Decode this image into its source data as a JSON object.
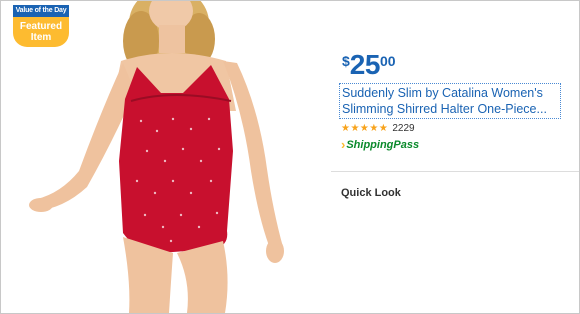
{
  "badge": {
    "top_label": "Value of the Day",
    "bottom_label": "Featured Item"
  },
  "product": {
    "price_currency": "$",
    "price_whole": "25",
    "price_cents": "00",
    "title": "Suddenly Slim by Catalina Women's Slimming Shirred Halter One-Piece...",
    "rating_stars": "★★★★★",
    "rating": 4.5,
    "review_count": "2229",
    "shipping_prefix": "Shipping",
    "shipping_suffix": "Pass"
  },
  "quick_look_label": "Quick Look",
  "colors": {
    "brand_blue": "#1a63b3",
    "badge_yellow": "#fdbb30",
    "swimsuit_red": "#c8102e",
    "shipping_green": "#0a8a2b"
  },
  "icons": [
    "product-photo",
    "star-icon",
    "shipping-chevron-icon"
  ]
}
